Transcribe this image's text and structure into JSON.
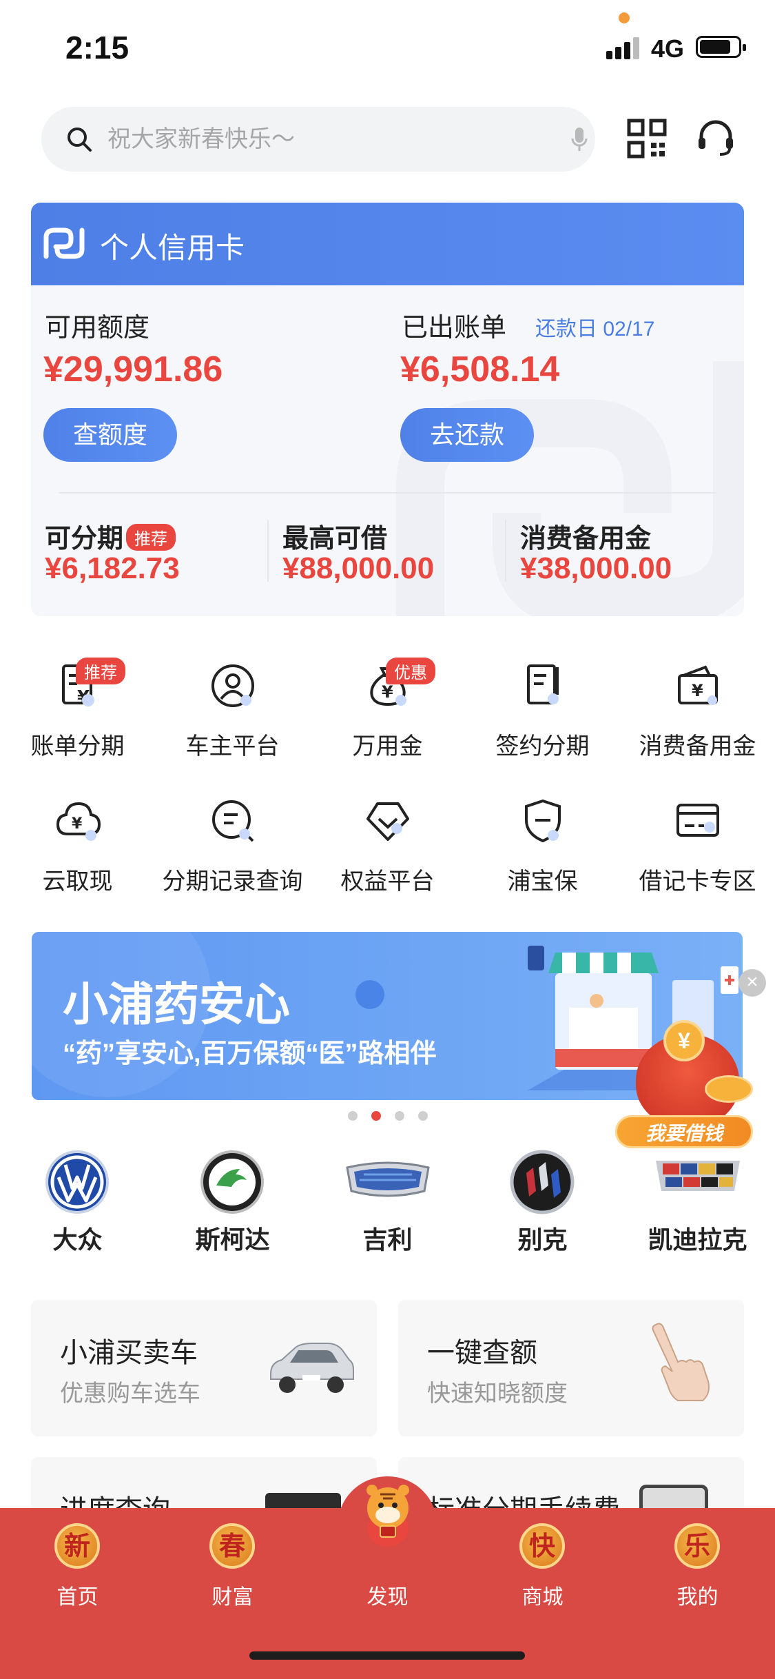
{
  "status_bar": {
    "time": "2:15",
    "network": "4G"
  },
  "search": {
    "placeholder": "祝大家新春快乐～"
  },
  "credit_card": {
    "title": "个人信用卡",
    "available_label": "可用额度",
    "available_amount": "¥29,991.86",
    "available_button": "查额度",
    "billed_label": "已出账单",
    "repay_date": "还款日 02/17",
    "billed_amount": "¥6,508.14",
    "billed_button": "去还款",
    "sub": [
      {
        "label": "可分期",
        "tag": "推荐",
        "amount": "¥6,182.73"
      },
      {
        "label": "最高可借",
        "amount": "¥88,000.00"
      },
      {
        "label": "消费备用金",
        "amount": "¥38,000.00"
      }
    ]
  },
  "services": [
    {
      "label": "账单分期",
      "badge": "推荐",
      "icon": "bill-installment-icon"
    },
    {
      "label": "车主平台",
      "icon": "car-owner-icon"
    },
    {
      "label": "万用金",
      "badge": "优惠",
      "icon": "money-bag-icon"
    },
    {
      "label": "签约分期",
      "icon": "contract-icon"
    },
    {
      "label": "消费备用金",
      "icon": "wallet-icon"
    },
    {
      "label": "云取现",
      "icon": "cloud-cash-icon"
    },
    {
      "label": "分期记录查询",
      "icon": "record-search-icon"
    },
    {
      "label": "权益平台",
      "icon": "diamond-icon"
    },
    {
      "label": "浦宝保",
      "icon": "shield-icon"
    },
    {
      "label": "借记卡专区",
      "icon": "debit-card-icon"
    }
  ],
  "banner": {
    "title": "小浦药安心",
    "subtitle": "“药”享安心,百万保额“医”路相伴",
    "active_index": 1,
    "count": 4
  },
  "float_loan": {
    "label": "我要借钱"
  },
  "car_brands": [
    {
      "name": "大众",
      "icon": "volkswagen-logo-icon"
    },
    {
      "name": "斯柯达",
      "icon": "skoda-logo-icon"
    },
    {
      "name": "吉利",
      "icon": "geely-logo-icon"
    },
    {
      "name": "别克",
      "icon": "buick-logo-icon"
    },
    {
      "name": "凯迪拉克",
      "icon": "cadillac-logo-icon"
    }
  ],
  "service_cards": [
    {
      "title": "小浦买卖车",
      "subtitle": "优惠购车选车"
    },
    {
      "title": "一键查额",
      "subtitle": "快速知晓额度"
    },
    {
      "title": "进度查询",
      "subtitle": ""
    },
    {
      "title": "标准分期手续费",
      "subtitle": ""
    }
  ],
  "tabbar": [
    {
      "coin": "新",
      "label": "首页"
    },
    {
      "coin": "春",
      "label": "财富"
    },
    {
      "coin": "",
      "label": "发现"
    },
    {
      "coin": "快",
      "label": "商城"
    },
    {
      "coin": "乐",
      "label": "我的"
    }
  ],
  "colors": {
    "brand_blue": "#4f81e8",
    "accent_red": "#e8463f",
    "tabbar_red": "#d94a45"
  }
}
